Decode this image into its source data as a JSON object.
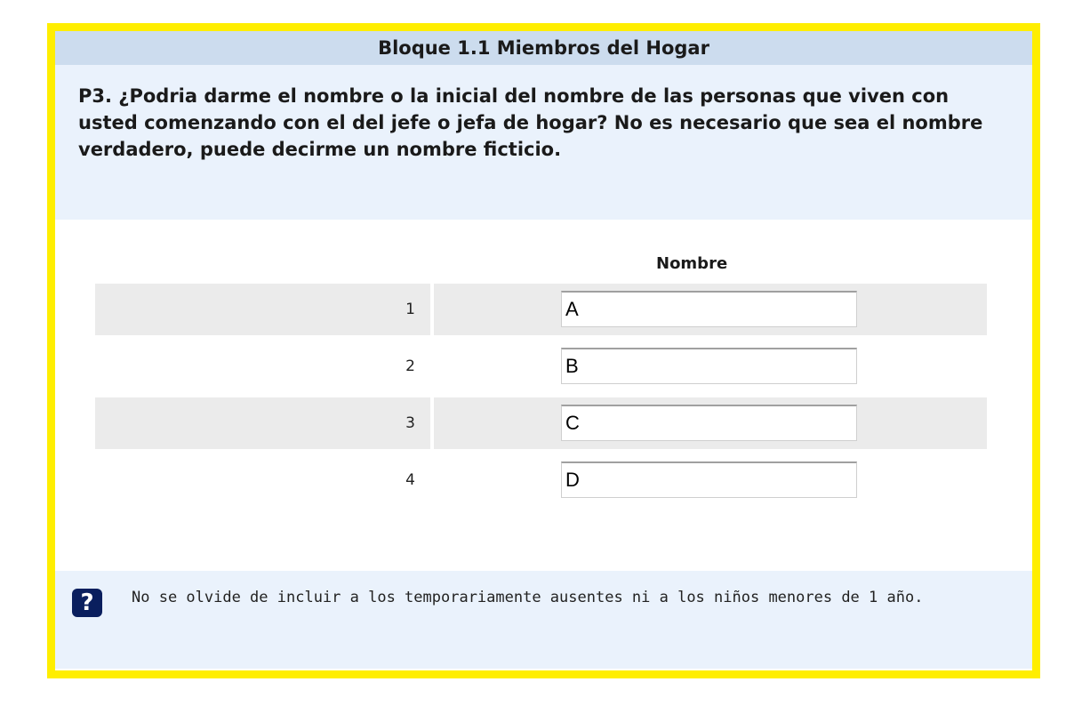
{
  "block_title": "Bloque 1.1 Miembros del Hogar",
  "question_text": "P3. ¿Podria darme el nombre o la inicial del nombre de las personas que viven con usted comenzando con el del jefe o jefa de hogar? No es necesario que sea el nombre verdadero, puede decirme un nombre ficticio.",
  "table": {
    "column_header": "Nombre",
    "rows": [
      {
        "number": "1",
        "value": "A"
      },
      {
        "number": "2",
        "value": "B"
      },
      {
        "number": "3",
        "value": "C"
      },
      {
        "number": "4",
        "value": "D"
      }
    ]
  },
  "help": {
    "icon": "question-icon",
    "icon_glyph": "?",
    "text": "No se olvide de incluir a los temporariamente ausentes ni a los niños menores de 1 año."
  },
  "colors": {
    "frame_border": "#ffee00",
    "title_bar": "#ccdcee",
    "panel": "#eaf2fc",
    "row_shade": "#ebebeb",
    "help_icon": "#0a1f5e"
  }
}
